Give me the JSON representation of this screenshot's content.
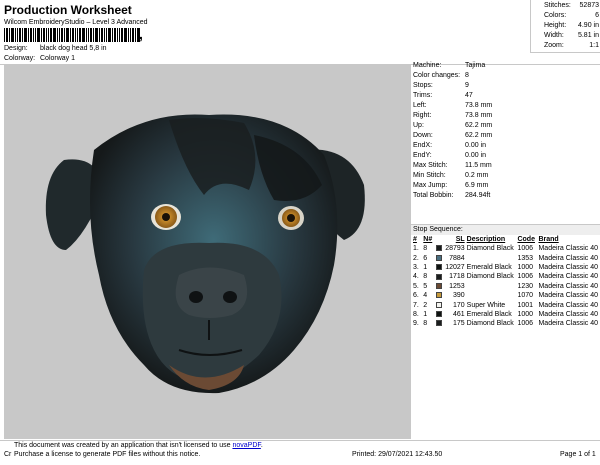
{
  "header": {
    "title": "Production Worksheet",
    "subtitle": "Wilcom EmbroideryStudio – Level 3 Advanced",
    "barcode_char": ","
  },
  "summary": {
    "items": [
      {
        "label": "Stitches:",
        "value": "52873"
      },
      {
        "label": "Colors:",
        "value": "6"
      },
      {
        "label": "Height:",
        "value": "4.90 in"
      },
      {
        "label": "Width:",
        "value": "5.81 in"
      },
      {
        "label": "Zoom:",
        "value": "1:1"
      }
    ]
  },
  "design": {
    "design_label": "Design:",
    "design_value": "black dog head 5,8 in",
    "colorway_label": "Colorway:",
    "colorway_value": "Colorway 1"
  },
  "stats": [
    {
      "label": "Machine:",
      "value": "Tajima"
    },
    {
      "label": "Color changes:",
      "value": "8"
    },
    {
      "label": "Stops:",
      "value": "9"
    },
    {
      "label": "Trims:",
      "value": "47"
    },
    {
      "label": "Left:",
      "value": "73.8 mm"
    },
    {
      "label": "Right:",
      "value": "73.8 mm"
    },
    {
      "label": "Up:",
      "value": "62.2 mm"
    },
    {
      "label": "Down:",
      "value": "62.2 mm"
    },
    {
      "label": "EndX:",
      "value": "0.00 in"
    },
    {
      "label": "EndY:",
      "value": "0.00 in"
    },
    {
      "label": "Max Stitch:",
      "value": "11.5 mm"
    },
    {
      "label": "Min Stitch:",
      "value": "0.2 mm"
    },
    {
      "label": "Max Jump:",
      "value": "6.9 mm"
    },
    {
      "label": "Total Bobbin:",
      "value": "284.94ft"
    }
  ],
  "stop_sequence": {
    "title": "Stop Sequence:",
    "headers": [
      "#",
      "N#",
      "",
      "SL",
      "Description",
      "Code",
      "Brand"
    ],
    "rows": [
      {
        "n": "1.",
        "nn": "8",
        "color": "#1a1d1d",
        "sl": "28793",
        "desc": "Diamond Black",
        "code": "1006",
        "brand": "Madeira Classic 40"
      },
      {
        "n": "2.",
        "nn": "6",
        "color": "#4a6f80",
        "sl": "7884",
        "desc": "",
        "code": "1353",
        "brand": "Madeira Classic 40"
      },
      {
        "n": "3.",
        "nn": "1",
        "color": "#0e1210",
        "sl": "12027",
        "desc": "Emerald Black",
        "code": "1000",
        "brand": "Madeira Classic 40"
      },
      {
        "n": "4.",
        "nn": "8",
        "color": "#1a1d1d",
        "sl": "1718",
        "desc": "Diamond Black",
        "code": "1006",
        "brand": "Madeira Classic 40"
      },
      {
        "n": "5.",
        "nn": "5",
        "color": "#6b4a34",
        "sl": "1253",
        "desc": "",
        "code": "1230",
        "brand": "Madeira Classic 40"
      },
      {
        "n": "6.",
        "nn": "4",
        "color": "#c69a3c",
        "sl": "390",
        "desc": "",
        "code": "1070",
        "brand": "Madeira Classic 40"
      },
      {
        "n": "7.",
        "nn": "2",
        "color": "#f4f4f0",
        "sl": "170",
        "desc": "Super White",
        "code": "1001",
        "brand": "Madeira Classic 40"
      },
      {
        "n": "8.",
        "nn": "1",
        "color": "#0e1210",
        "sl": "461",
        "desc": "Emerald Black",
        "code": "1000",
        "brand": "Madeira Classic 40"
      },
      {
        "n": "9.",
        "nn": "8",
        "color": "#1a1d1d",
        "sl": "175",
        "desc": "Diamond Black",
        "code": "1006",
        "brand": "Madeira Classic 40"
      }
    ]
  },
  "footer": {
    "notice_line1": "This document was created by an application that isn't licensed to use ",
    "notice_link": "novaPDF",
    "notice_line1_end": ".",
    "notice_line2": "Purchase a license to generate PDF files without this notice.",
    "cr": "Cr",
    "printed": "Printed: 29/07/2021 12:43.50",
    "page": "Page 1 of 1"
  },
  "colors": {
    "background_panel": "#c8c8c8",
    "dog_main": "#283840",
    "dog_teal": "#3f6b78",
    "dog_dark": "#15191a",
    "eye": "#c68a2a",
    "nose": "#3a4448",
    "link": "#0000cc"
  },
  "icons": [
    "barcode-icon",
    "embroidered-dog-head-image"
  ]
}
